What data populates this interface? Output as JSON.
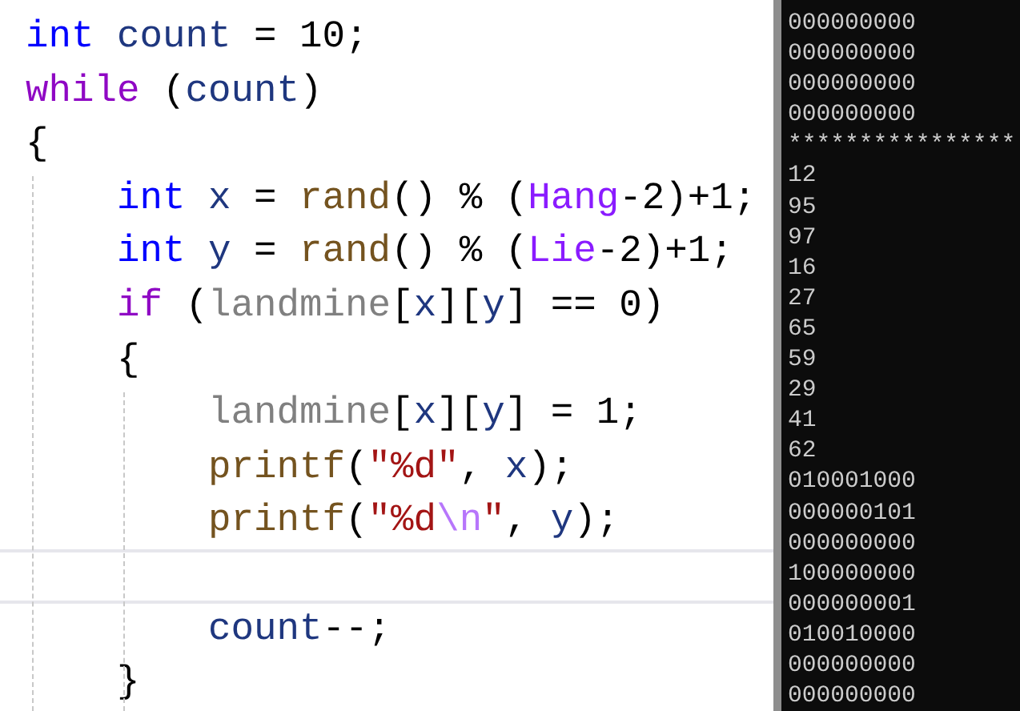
{
  "editor": {
    "lines": [
      {
        "current": false,
        "tokens": [
          {
            "text": "int ",
            "kind": "keyword"
          },
          {
            "text": "count",
            "kind": "ident"
          },
          {
            "text": " = 10;",
            "kind": "punct"
          }
        ]
      },
      {
        "current": false,
        "tokens": [
          {
            "text": "while",
            "kind": "control"
          },
          {
            "text": " (",
            "kind": "punct"
          },
          {
            "text": "count",
            "kind": "ident"
          },
          {
            "text": ")",
            "kind": "punct"
          }
        ]
      },
      {
        "current": false,
        "tokens": [
          {
            "text": "{",
            "kind": "punct"
          }
        ]
      },
      {
        "current": false,
        "tokens": [
          {
            "text": "    int ",
            "kind": "keyword"
          },
          {
            "text": "x",
            "kind": "ident"
          },
          {
            "text": " = ",
            "kind": "punct"
          },
          {
            "text": "rand",
            "kind": "func"
          },
          {
            "text": "() % (",
            "kind": "punct"
          },
          {
            "text": "Hang",
            "kind": "macro"
          },
          {
            "text": "-2)+1;",
            "kind": "punct"
          }
        ]
      },
      {
        "current": false,
        "tokens": [
          {
            "text": "    int ",
            "kind": "keyword"
          },
          {
            "text": "y",
            "kind": "ident"
          },
          {
            "text": " = ",
            "kind": "punct"
          },
          {
            "text": "rand",
            "kind": "func"
          },
          {
            "text": "() % (",
            "kind": "punct"
          },
          {
            "text": "Lie",
            "kind": "macro"
          },
          {
            "text": "-2)+1;",
            "kind": "punct"
          }
        ]
      },
      {
        "current": false,
        "tokens": [
          {
            "text": "    if",
            "kind": "control"
          },
          {
            "text": " (",
            "kind": "punct"
          },
          {
            "text": "landmine",
            "kind": "global"
          },
          {
            "text": "[",
            "kind": "punct"
          },
          {
            "text": "x",
            "kind": "ident"
          },
          {
            "text": "][",
            "kind": "punct"
          },
          {
            "text": "y",
            "kind": "ident"
          },
          {
            "text": "] == 0)",
            "kind": "punct"
          }
        ]
      },
      {
        "current": false,
        "tokens": [
          {
            "text": "    {",
            "kind": "punct"
          }
        ]
      },
      {
        "current": false,
        "tokens": [
          {
            "text": "        landmine",
            "kind": "global"
          },
          {
            "text": "[",
            "kind": "punct"
          },
          {
            "text": "x",
            "kind": "ident"
          },
          {
            "text": "][",
            "kind": "punct"
          },
          {
            "text": "y",
            "kind": "ident"
          },
          {
            "text": "] = 1;",
            "kind": "punct"
          }
        ]
      },
      {
        "current": false,
        "tokens": [
          {
            "text": "        printf",
            "kind": "func"
          },
          {
            "text": "(",
            "kind": "punct"
          },
          {
            "text": "\"%d\"",
            "kind": "string"
          },
          {
            "text": ", ",
            "kind": "punct"
          },
          {
            "text": "x",
            "kind": "ident"
          },
          {
            "text": ");",
            "kind": "punct"
          }
        ]
      },
      {
        "current": false,
        "tokens": [
          {
            "text": "        printf",
            "kind": "func"
          },
          {
            "text": "(",
            "kind": "punct"
          },
          {
            "text": "\"%d",
            "kind": "string"
          },
          {
            "text": "\\n",
            "kind": "escape"
          },
          {
            "text": "\"",
            "kind": "string"
          },
          {
            "text": ", ",
            "kind": "punct"
          },
          {
            "text": "y",
            "kind": "ident"
          },
          {
            "text": ");",
            "kind": "punct"
          }
        ]
      },
      {
        "current": true
      },
      {
        "current": false,
        "tokens": [
          {
            "text": "        count",
            "kind": "ident"
          },
          {
            "text": "--;",
            "kind": "punct"
          }
        ]
      },
      {
        "current": false,
        "tokens": [
          {
            "text": "    }",
            "kind": "punct"
          }
        ]
      }
    ]
  },
  "console": {
    "lines": [
      "000000000",
      "000000000",
      "000000000",
      "000000000",
      "****************",
      "12",
      "95",
      "97",
      "16",
      "27",
      "65",
      "59",
      "29",
      "41",
      "62",
      "010001000",
      "000000101",
      "000000000",
      "100000000",
      "000000001",
      "010010000",
      "000000000",
      "000000000"
    ]
  }
}
